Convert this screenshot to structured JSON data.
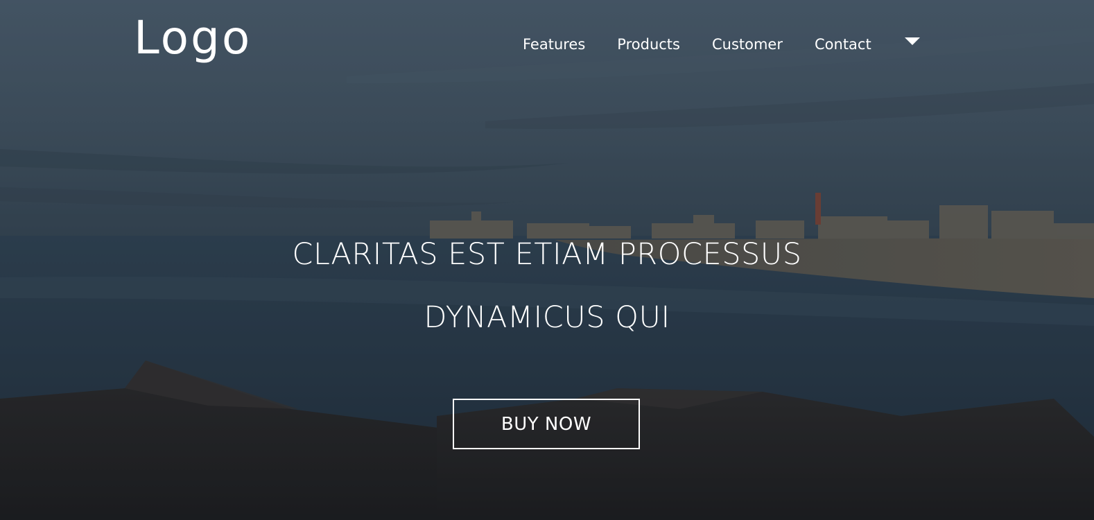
{
  "header": {
    "logo_text": "Logo",
    "nav": [
      {
        "label": "Features"
      },
      {
        "label": "Products"
      },
      {
        "label": "Customer"
      },
      {
        "label": "Contact"
      }
    ],
    "dropdown_icon": "caret-down-icon"
  },
  "hero": {
    "line1": "CLARITAS EST ETIAM PROCESSUS",
    "line2": "DYNAMICUS QUI",
    "cta_label": "BUY NOW",
    "background": "beach-coastline-photo"
  },
  "colors": {
    "text": "#ffffff",
    "sky": "#4f6472",
    "water": "#2f3f4d",
    "rocks": "#1f262d"
  }
}
